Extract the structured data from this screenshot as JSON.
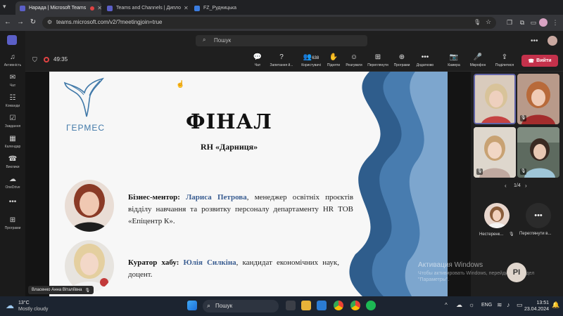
{
  "browser": {
    "tabs": [
      {
        "label": "Нарада | Microsoft Teams",
        "active": true
      },
      {
        "label": "Teams and Channels | Дипло",
        "active": false
      },
      {
        "label": "FZ_Рудницька",
        "active": false
      }
    ],
    "url": "teams.microsoft.com/v2/?meetingjoin=true"
  },
  "appbar": {
    "items": [
      {
        "label": "Активність",
        "icon": "bell-icon"
      },
      {
        "label": "Чат",
        "icon": "chat-icon"
      },
      {
        "label": "Команди",
        "icon": "teams-icon"
      },
      {
        "label": "Завдання",
        "icon": "tasks-icon"
      },
      {
        "label": "Календар",
        "icon": "calendar-icon"
      },
      {
        "label": "Виклики",
        "icon": "phone-icon"
      },
      {
        "label": "OneDrive",
        "icon": "cloud-icon"
      },
      {
        "label": "",
        "icon": "more-icon"
      },
      {
        "label": "Програми",
        "icon": "apps-icon"
      }
    ]
  },
  "header": {
    "search_placeholder": "Пошук"
  },
  "meeting": {
    "timer": "49:35",
    "toolbar": {
      "chat": "Чат",
      "questions": "Запитання й...",
      "participants_count": "638",
      "participants": "Користувачі",
      "raise": "Підняти",
      "react": "Реагувати",
      "view": "Переглянути",
      "apps": "Програми",
      "more": "Додатково",
      "camera": "Камера",
      "mic": "Мікрофон",
      "share": "Поділитися",
      "leave": "Вийти"
    },
    "presenter_name": "Власенко Анна Віталіївна"
  },
  "slide": {
    "logo_text": "ГЕРМЕС",
    "title": "ФІНАЛ",
    "subtitle": "RH «Дарниця»",
    "mentor": {
      "role": "Бізнес-ментор:",
      "name": "Лариса Петрова",
      "desc": ", менеджер освітніх проєктів відділу навчання та розвитку персоналу департаменту HR ТОВ «Епіцентр К»."
    },
    "curator": {
      "role": "Куратор хабу:",
      "name": "Юлія Силкіна",
      "desc": ", кандидат економічних наук, доцент."
    }
  },
  "panel": {
    "pager": "1/4",
    "participant_1": "Нестеренк...",
    "participant_2": "Переглянути в...",
    "avatar_initials": "PI"
  },
  "watermark": {
    "line1": "Активация Windows",
    "line2": "Чтобы активировать Windows, перейдите в раздел \"Параметры\"."
  },
  "taskbar": {
    "weather_temp": "13°C",
    "weather_desc": "Mostly cloudy",
    "search": "Пошук",
    "lang": "ENG",
    "time": "13:51",
    "date": "23.04.2024"
  }
}
